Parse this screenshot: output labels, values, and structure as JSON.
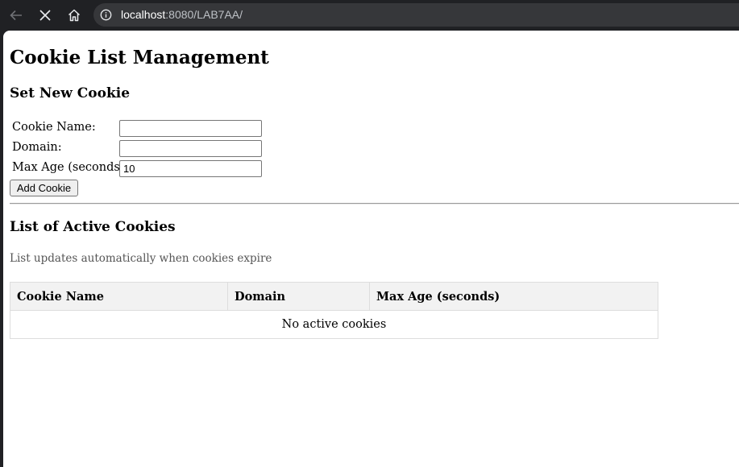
{
  "browser": {
    "url_host": "localhost",
    "url_rest": ":8080/LAB7AA/"
  },
  "page": {
    "title": "Cookie List Management",
    "set_heading": "Set New Cookie",
    "form": {
      "name_label": "Cookie Name:",
      "name_value": "",
      "domain_label": "Domain:",
      "domain_value": "",
      "maxage_label": "Max Age (seconds):",
      "maxage_value": "10",
      "add_button": "Add Cookie"
    },
    "list_heading": "List of Active Cookies",
    "list_note": "List updates automatically when cookies expire",
    "table": {
      "columns": [
        "Cookie Name",
        "Domain",
        "Max Age (seconds)"
      ],
      "empty_message": "No active cookies"
    }
  }
}
